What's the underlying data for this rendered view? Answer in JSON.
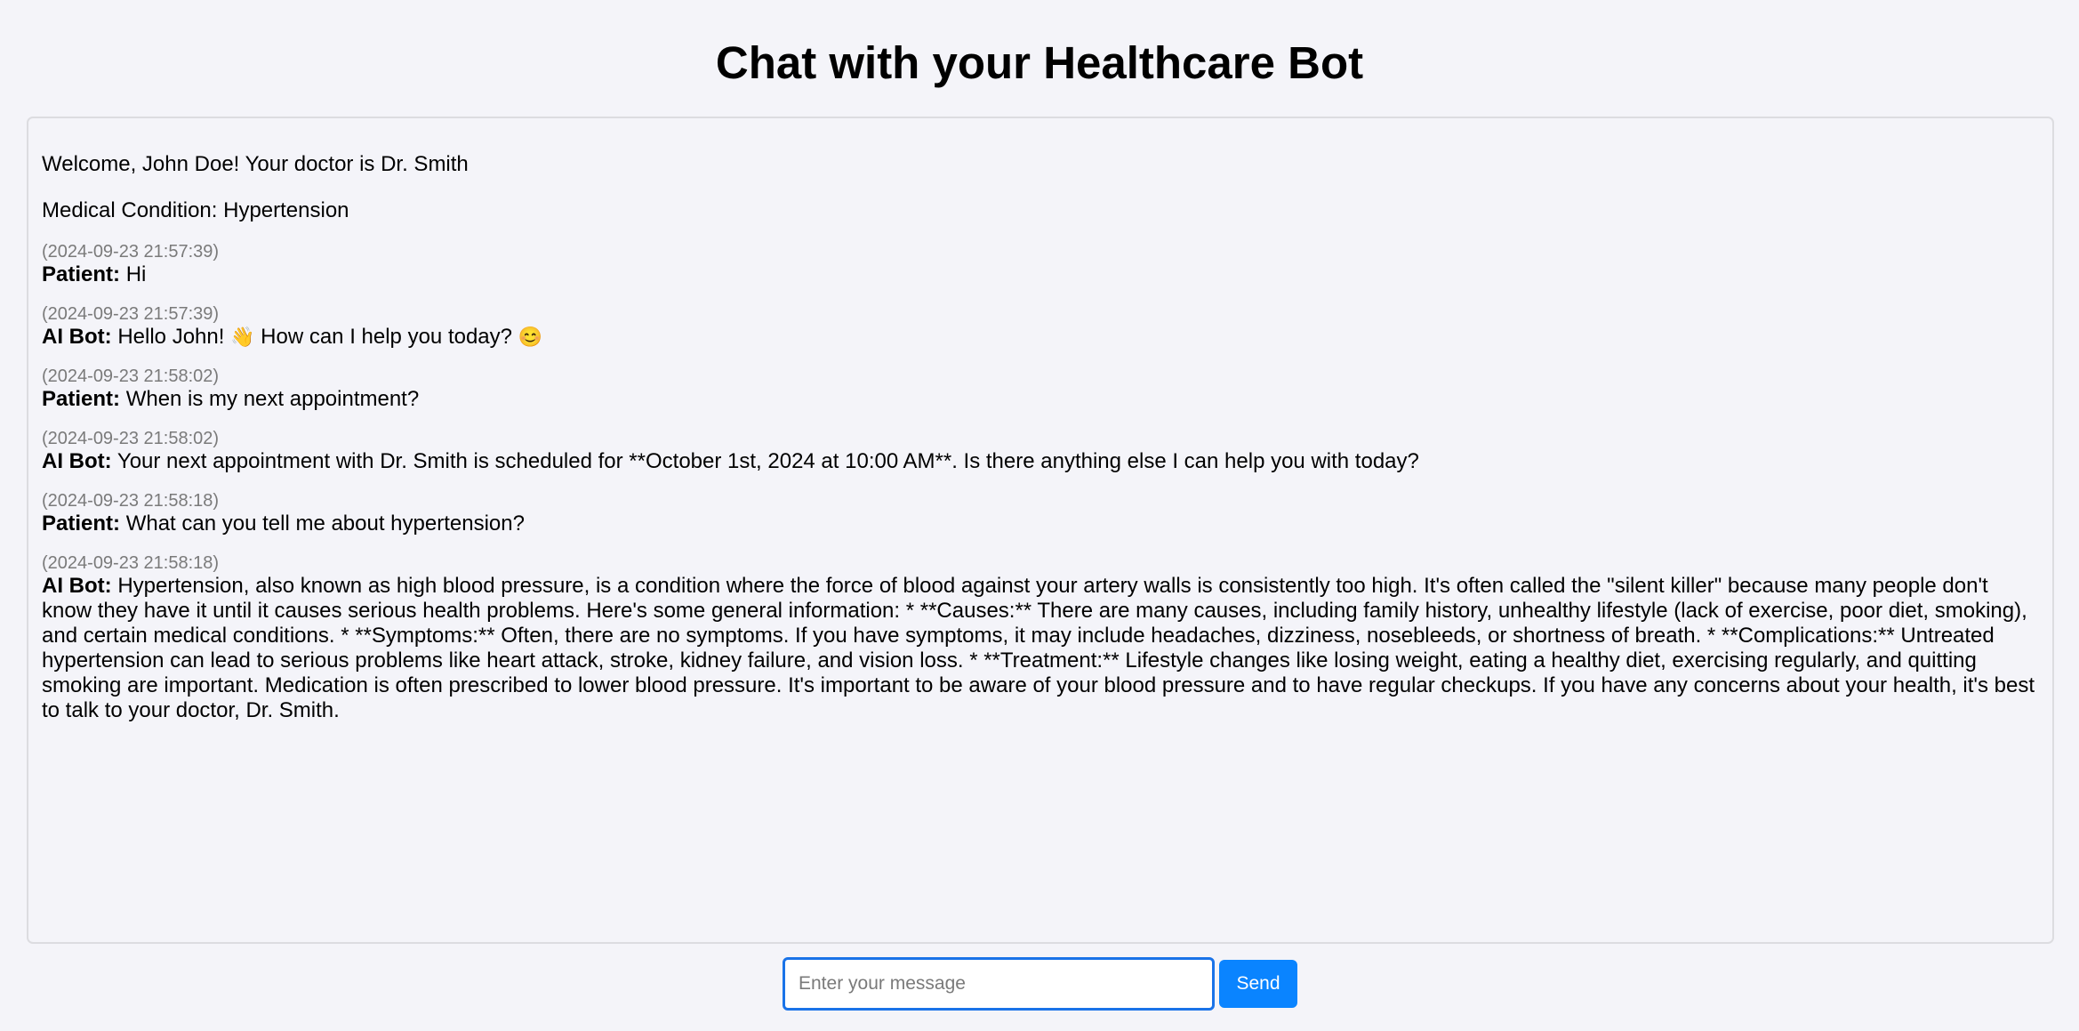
{
  "page": {
    "title": "Chat with your Healthcare Bot"
  },
  "chat": {
    "welcome": "Welcome, John Doe! Your doctor is Dr. Smith",
    "condition": "Medical Condition: Hypertension",
    "messages": [
      {
        "timestamp": "(2024-09-23 21:57:39)",
        "sender": "Patient:",
        "text": "Hi"
      },
      {
        "timestamp": "(2024-09-23 21:57:39)",
        "sender": "AI Bot:",
        "text": "Hello John! ",
        "emoji1": "👋",
        "text2": " How can I help you today? ",
        "emoji2": "😊"
      },
      {
        "timestamp": "(2024-09-23 21:58:02)",
        "sender": "Patient:",
        "text": "When is my next appointment?"
      },
      {
        "timestamp": "(2024-09-23 21:58:02)",
        "sender": "AI Bot:",
        "text": "Your next appointment with Dr. Smith is scheduled for **October 1st, 2024 at 10:00 AM**. Is there anything else I can help you with today?"
      },
      {
        "timestamp": "(2024-09-23 21:58:18)",
        "sender": "Patient:",
        "text": "What can you tell me about hypertension?"
      },
      {
        "timestamp": "(2024-09-23 21:58:18)",
        "sender": "AI Bot:",
        "text": "Hypertension, also known as high blood pressure, is a condition where the force of blood against your artery walls is consistently too high. It's often called the \"silent killer\" because many people don't know they have it until it causes serious health problems. Here's some general information: * **Causes:** There are many causes, including family history, unhealthy lifestyle (lack of exercise, poor diet, smoking), and certain medical conditions. * **Symptoms:** Often, there are no symptoms. If you have symptoms, it may include headaches, dizziness, nosebleeds, or shortness of breath. * **Complications:** Untreated hypertension can lead to serious problems like heart attack, stroke, kidney failure, and vision loss. * **Treatment:** Lifestyle changes like losing weight, eating a healthy diet, exercising regularly, and quitting smoking are important. Medication is often prescribed to lower blood pressure. It's important to be aware of your blood pressure and to have regular checkups. If you have any concerns about your health, it's best to talk to your doctor, Dr. Smith."
      }
    ]
  },
  "input": {
    "placeholder": "Enter your message",
    "value": ""
  },
  "send": {
    "label": "Send"
  },
  "colors": {
    "background": "#f4f4f9",
    "accent": "#0a84ff",
    "input_border": "#1a73e8",
    "timestamp": "#7a7a7a"
  }
}
